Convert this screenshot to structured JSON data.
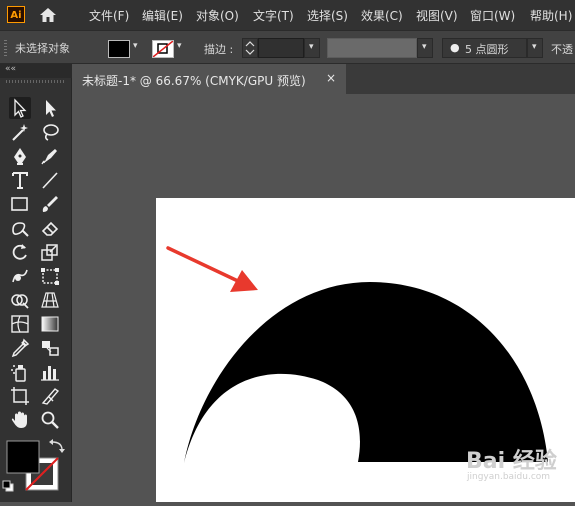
{
  "app": {
    "logo_text": "Ai",
    "menu": [
      "文件(F)",
      "编辑(E)",
      "对象(O)",
      "文字(T)",
      "选择(S)",
      "效果(C)",
      "视图(V)",
      "窗口(W)",
      "帮助(H)"
    ]
  },
  "control_bar": {
    "selection_status": "未选择对象",
    "stroke_label": "描边 :",
    "brush_label": "5 点圆形",
    "opacity_label": "不透"
  },
  "document": {
    "tab_title": "未标题-1* @ 66.67% (CMYK/GPU 预览)",
    "close_glyph": "×"
  },
  "toolbar": {
    "collapse_glyph": "««",
    "tools": [
      "selection",
      "direct-selection",
      "magic-wand",
      "lasso",
      "pen",
      "curvature",
      "type",
      "line-segment",
      "rectangle",
      "paintbrush",
      "shaper",
      "eraser",
      "rotate",
      "scale",
      "warp",
      "free-transform",
      "shape-builder",
      "perspective-grid",
      "mesh",
      "gradient",
      "eyedropper",
      "blend",
      "symbol-sprayer",
      "column-graph",
      "artboard",
      "slice",
      "hand",
      "zoom"
    ]
  },
  "watermark": {
    "text": "Bai 经验",
    "url": "jingyan.baidu.com"
  },
  "colors": {
    "menubar": "#323232",
    "canvas": "#535353",
    "artboard": "#ffffff",
    "arrow": "#e8392d",
    "shape": "#000000",
    "accent": "#ff9a00"
  }
}
